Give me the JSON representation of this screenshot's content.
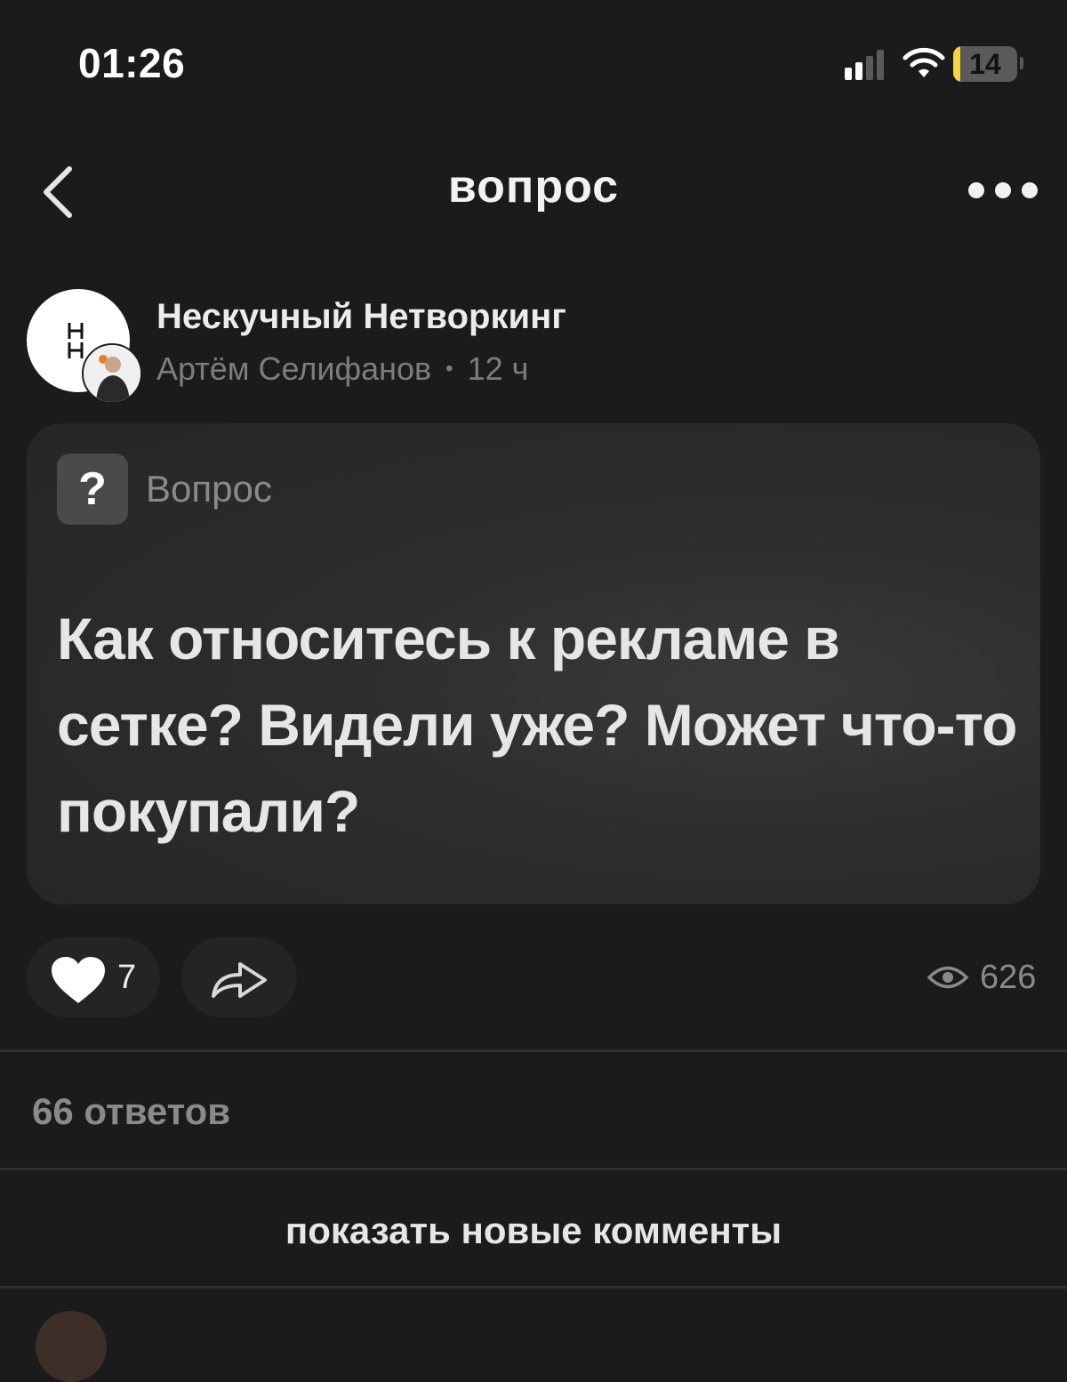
{
  "status_bar": {
    "time": "01:26",
    "battery": "14",
    "icons": [
      "signal-icon",
      "wifi-icon",
      "battery-icon"
    ]
  },
  "top_bar": {
    "title": "вопрос",
    "back_icon": "chevron-left-icon",
    "more_icon": "ellipsis-icon"
  },
  "post": {
    "community_name": "Нескучный Нетворкинг",
    "author": "Артём Селифанов",
    "separator": "•",
    "time_ago": "12 ч",
    "type_icon": "?",
    "type_label": "Вопрос",
    "question": "Как относитесь к рекламе в сетке? Видели уже? Может что-то покупали?"
  },
  "actions": {
    "likes": "7",
    "views": "626",
    "icons": [
      "heart-icon",
      "share-icon",
      "eye-icon"
    ]
  },
  "comments": {
    "count_label": "66 ответов",
    "show_new_label": "показать новые комменты"
  },
  "colors": {
    "background": "#1b1b1c",
    "card": "#2c2c2e",
    "battery_fill": "#f5d33b",
    "muted_text": "#8a8a8d"
  }
}
